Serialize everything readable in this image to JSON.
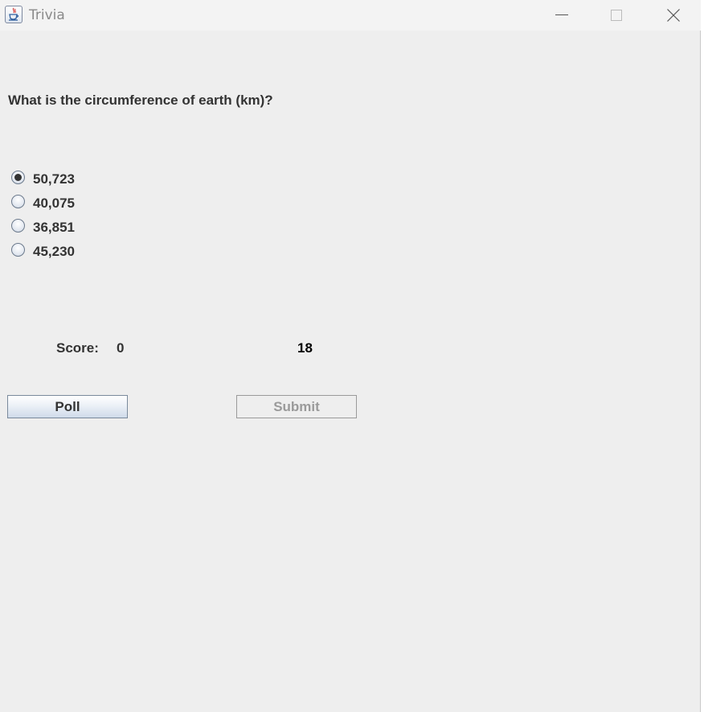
{
  "window": {
    "title": "Trivia"
  },
  "question": {
    "text": "What is the circumference of earth (km)?"
  },
  "options": [
    {
      "label": "50,723",
      "selected": true
    },
    {
      "label": "40,075",
      "selected": false
    },
    {
      "label": "36,851",
      "selected": false
    },
    {
      "label": "45,230",
      "selected": false
    }
  ],
  "score": {
    "label": "Score:",
    "value": "0"
  },
  "timer": {
    "value": "18"
  },
  "buttons": {
    "poll_label": "Poll",
    "submit_label": "Submit",
    "submit_enabled": false
  }
}
